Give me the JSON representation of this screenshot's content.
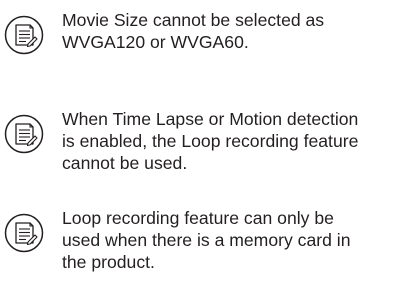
{
  "notes": [
    {
      "icon": "note-icon",
      "text": "Movie Size cannot be selected as\nWVGA120 or WVGA60."
    },
    {
      "icon": "note-icon",
      "text": "When Time Lapse or Motion detection\nis enabled, the Loop recording feature\ncannot be used."
    },
    {
      "icon": "note-icon",
      "text": "Loop recording feature can only be\nused when there is a memory card in\nthe product."
    }
  ],
  "colors": {
    "text": "#231f20",
    "icon_stroke": "#231f20",
    "background": "#ffffff"
  }
}
